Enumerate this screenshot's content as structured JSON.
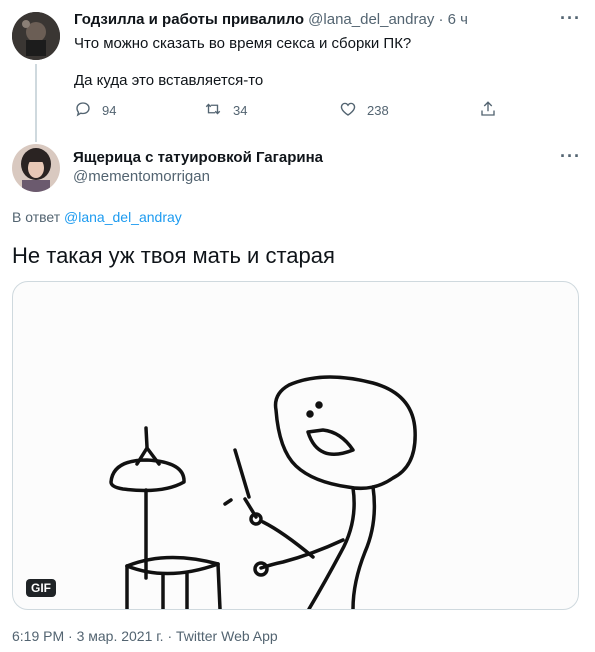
{
  "parent_tweet": {
    "display_name": "Годзилла и работы привалило",
    "handle": "@lana_del_andray",
    "time": "· 6 ч",
    "line1": "Что можно сказать во время секса и сборки ПК?",
    "line2": "Да куда это вставляется-то",
    "replies": "94",
    "retweets": "34",
    "likes": "238"
  },
  "main_tweet": {
    "display_name": "Ящерица с татуировкой Гагарина",
    "handle": "@mementomorrigan",
    "reply_prefix": "В ответ",
    "reply_to": "@lana_del_andray",
    "text": "Не такая уж твоя мать и старая",
    "gif_badge": "GIF",
    "footer": "6:19 PM · 3 мар. 2021 г. · Twitter Web App"
  },
  "icons": {
    "more": "more-icon",
    "reply": "reply-icon",
    "retweet": "retweet-icon",
    "like": "heart-icon",
    "share": "share-icon"
  },
  "colors": {
    "accent": "#1d9bf0",
    "muted": "#536471"
  }
}
